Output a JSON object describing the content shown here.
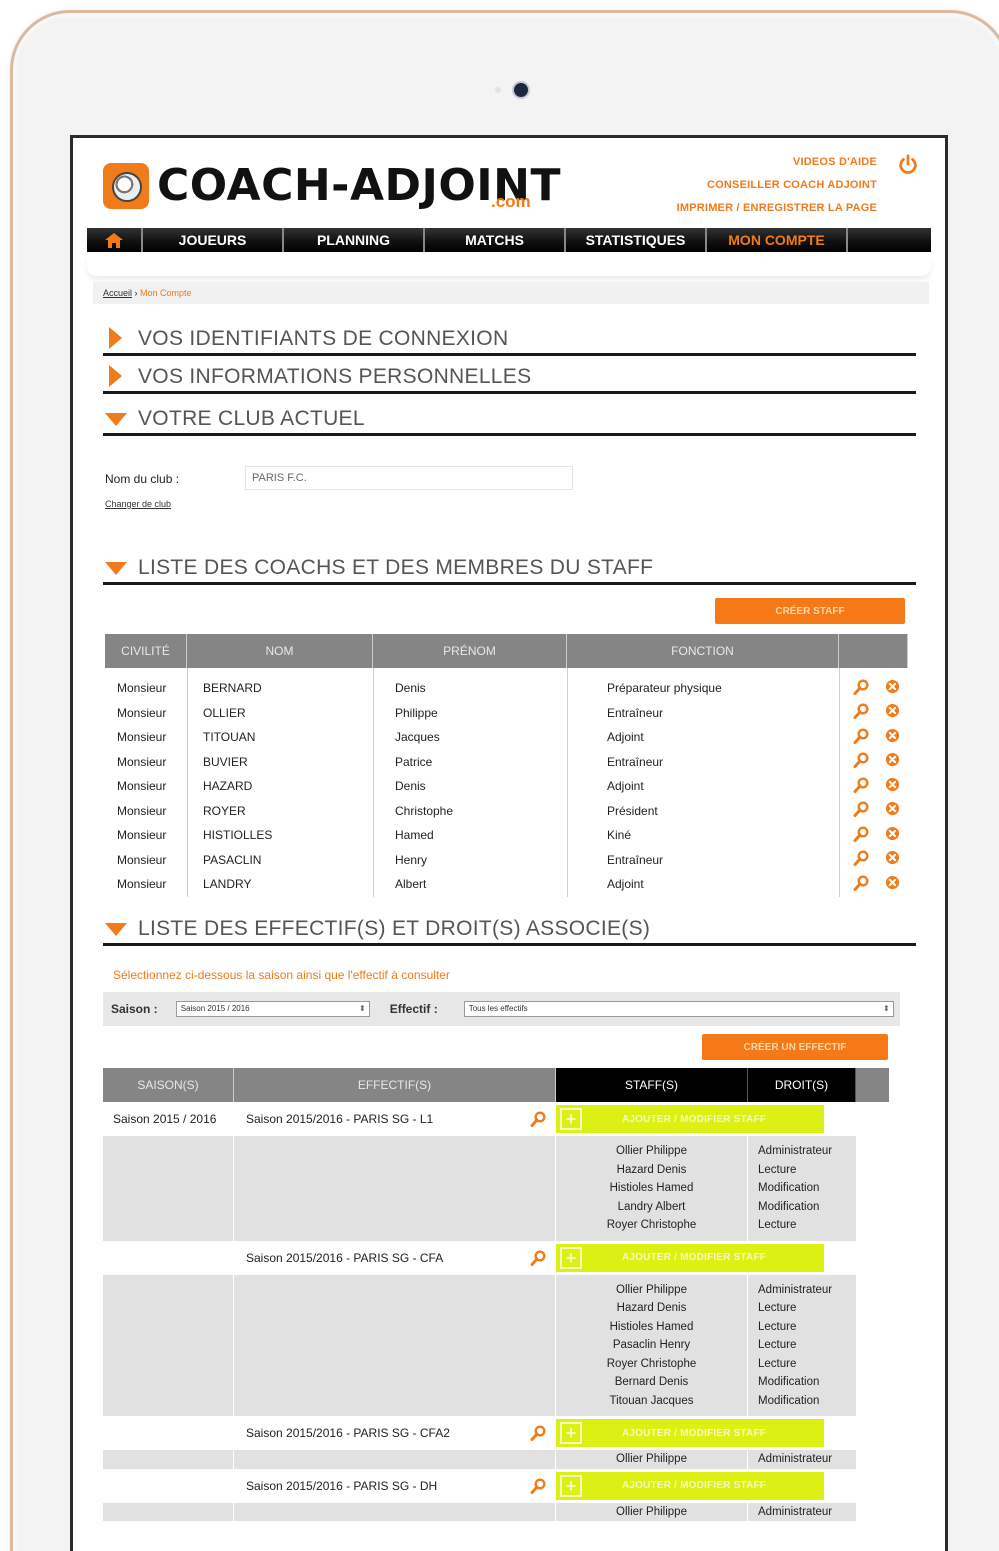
{
  "brand": {
    "name": "COACH-ADJOINT",
    "suffix": ".com",
    "accent": "#f07b1a"
  },
  "header_links": [
    "VIDEOS D'AIDE",
    "CONSEILLER COACH ADJOINT",
    "IMPRIMER / ENREGISTRER LA PAGE"
  ],
  "nav": {
    "home_icon": "home-icon",
    "items": [
      "JOUEURS",
      "PLANNING",
      "MATCHS",
      "STATISTIQUES",
      "MON COMPTE"
    ],
    "active": "MON COMPTE"
  },
  "breadcrumb": {
    "home": "Accueil",
    "separator": " › ",
    "current": "Mon Compte"
  },
  "sections": {
    "identifiants": "VOS IDENTIFIANTS DE CONNEXION",
    "infos": "VOS INFORMATIONS PERSONNELLES",
    "club": "VOTRE CLUB ACTUEL",
    "staff": "LISTE DES COACHS ET DES MEMBRES DU STAFF",
    "effectifs": "LISTE DES EFFECTIF(S) ET DROIT(S) ASSOCIE(S)"
  },
  "club": {
    "label": "Nom du club :",
    "value": "PARIS F.C.",
    "change_link": "Changer de club"
  },
  "staff": {
    "create_button": "CRÉER STAFF",
    "columns": [
      "CIVILITÉ",
      "NOM",
      "PRÉNOM",
      "FONCTION"
    ],
    "rows": [
      [
        "Monsieur",
        "BERNARD",
        "Denis",
        "Préparateur physique"
      ],
      [
        "Monsieur",
        "OLLIER",
        "Philippe",
        "Entraîneur"
      ],
      [
        "Monsieur",
        "TITOUAN",
        "Jacques",
        "Adjoint"
      ],
      [
        "Monsieur",
        "BUVIER",
        "Patrice",
        "Entraîneur"
      ],
      [
        "Monsieur",
        "HAZARD",
        "Denis",
        "Adjoint"
      ],
      [
        "Monsieur",
        "ROYER",
        "Christophe",
        "Président"
      ],
      [
        "Monsieur",
        "HISTIOLLES",
        "Hamed",
        "Kiné"
      ],
      [
        "Monsieur",
        "PASACLIN",
        "Henry",
        "Entraîneur"
      ],
      [
        "Monsieur",
        "LANDRY",
        "Albert",
        "Adjoint"
      ]
    ]
  },
  "effectifs": {
    "hint": "Sélectionnez ci-dessous la saison ainsi que l'effectif à consulter",
    "season_label": "Saison :",
    "season_value": "Saison 2015 / 2016",
    "effectif_label": "Effectif :",
    "effectif_value": "Tous les effectifs",
    "create_button": "CRÉER UN EFFECTIF",
    "columns": [
      "SAISON(S)",
      "EFFECTIF(S)",
      "STAFF(S)",
      "DROIT(S)"
    ],
    "add_staff_label": "AJOUTER / MODIFIER STAFF",
    "groups": [
      {
        "season": "Saison 2015 / 2016",
        "name": "Saison 2015/2016 - PARIS SG - L1",
        "staff": [
          "Ollier Philippe",
          "Hazard Denis",
          "Histioles Hamed",
          "Landry Albert",
          "Royer Christophe"
        ],
        "rights": [
          "Administrateur",
          "Lecture",
          "Modification",
          "Modification",
          "Lecture"
        ]
      },
      {
        "season": "",
        "name": "Saison 2015/2016 - PARIS SG - CFA",
        "staff": [
          "Ollier Philippe",
          "Hazard Denis",
          "Histioles Hamed",
          "Pasaclin Henry",
          "Royer Christophe",
          "Bernard Denis",
          "Titouan Jacques"
        ],
        "rights": [
          "Administrateur",
          "Lecture",
          "Lecture",
          "Lecture",
          "Lecture",
          "Modification",
          "Modification"
        ]
      },
      {
        "season": "",
        "name": "Saison 2015/2016 - PARIS SG - CFA2",
        "staff": [
          "Ollier Philippe"
        ],
        "rights": [
          "Administrateur"
        ]
      },
      {
        "season": "",
        "name": "Saison 2015/2016 - PARIS SG - DH",
        "staff": [
          "Ollier Philippe"
        ],
        "rights": [
          "Administrateur"
        ]
      }
    ]
  }
}
